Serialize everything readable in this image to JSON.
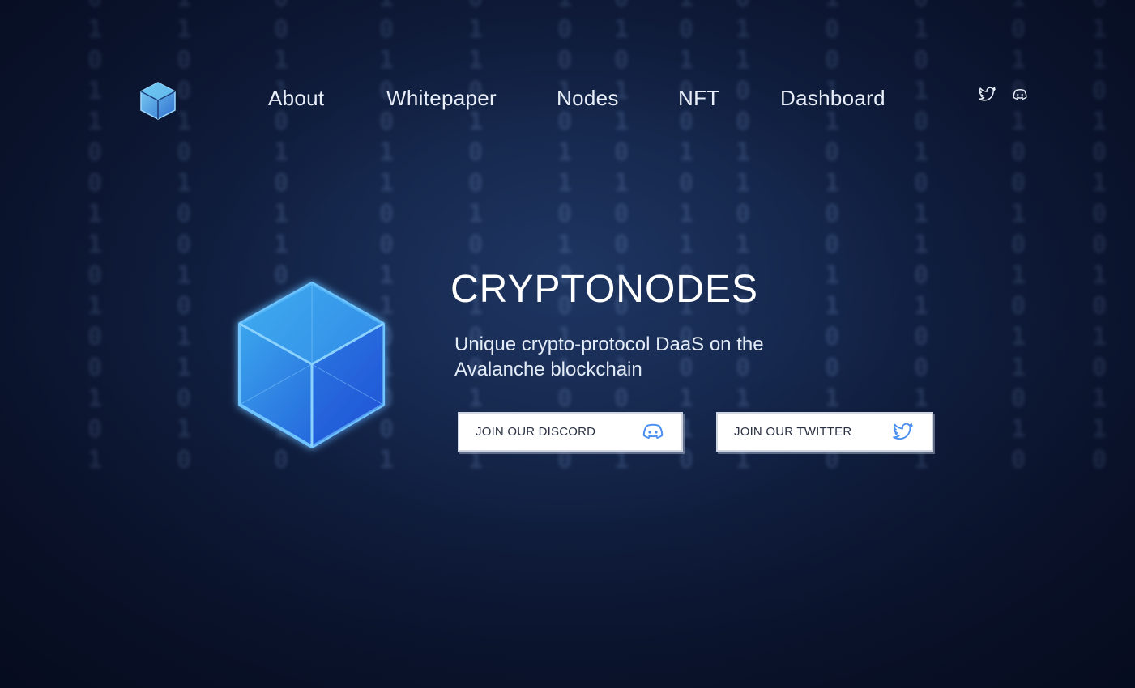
{
  "brand": {
    "logo_icon": "cube-logo-icon"
  },
  "nav": {
    "items": [
      {
        "label": "About"
      },
      {
        "label": "Whitepaper"
      },
      {
        "label": "Nodes"
      },
      {
        "label": "NFT"
      },
      {
        "label": "Dashboard"
      }
    ]
  },
  "social": {
    "twitter_icon": "twitter-icon",
    "discord_icon": "discord-icon"
  },
  "hero": {
    "title": "CRYPTONODES",
    "subtitle": "Unique crypto-protocol DaaS on the Avalanche blockchain",
    "discord_button": "JOIN OUR DISCORD",
    "twitter_button": "JOIN OUR TWITTER"
  },
  "colors": {
    "background": "#0c1631",
    "accent_blue": "#4a8ff0",
    "text_light": "#e8eef8",
    "button_bg": "#ffffff"
  }
}
